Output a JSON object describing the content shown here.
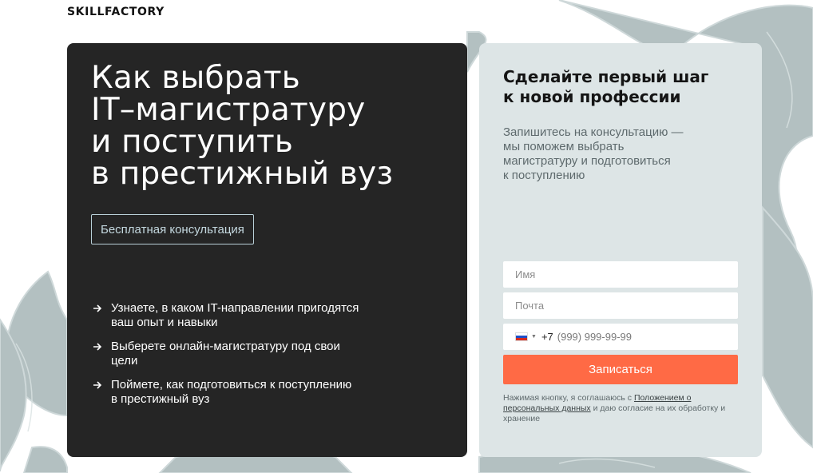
{
  "brand": {
    "logo_text": "SKILLFACTORY"
  },
  "hero": {
    "title_lines": [
      "Как выбрать",
      "IT–магистратуру",
      "и поступить",
      "в престижный вуз"
    ],
    "consult_button_label": "Бесплатная консультация",
    "benefits": [
      {
        "icon": "arrow-right-icon",
        "text": "Узнаете, в каком IT-направлении пригодятся\nваш опыт и навыки"
      },
      {
        "icon": "arrow-right-icon",
        "text": "Выберете онлайн-магистратуру под свои\nцели"
      },
      {
        "icon": "arrow-right-icon",
        "text": "Поймете, как подготовиться к поступлению\nв престижный вуз"
      }
    ]
  },
  "form": {
    "title": "Сделайте первый шаг\nк новой профессии",
    "description": "Запишитесь на консультацию —\nмы поможем выбрать\nмагистратуру и подготовиться\nк поступлению",
    "name_field": {
      "placeholder": "Имя",
      "value": ""
    },
    "email_field": {
      "placeholder": "Почта",
      "value": ""
    },
    "phone_field": {
      "country_flag": "russia-flag-icon",
      "country_code": "+7",
      "placeholder": "(999) 999-99-99",
      "value": ""
    },
    "submit_label": "Записаться",
    "consent": {
      "text_before": "Нажимая кнопку, я соглашаюсь с ",
      "link_text": "Положением о персональных данных",
      "text_after": " и даю согласие на их обработку и хранение"
    }
  },
  "colors": {
    "dark_card_bg": "#252525",
    "form_card_bg": "#dde5e6",
    "accent_button": "#ff6a45",
    "consult_button_border": "#b9d0d8",
    "background_art": "#aebcbd"
  }
}
